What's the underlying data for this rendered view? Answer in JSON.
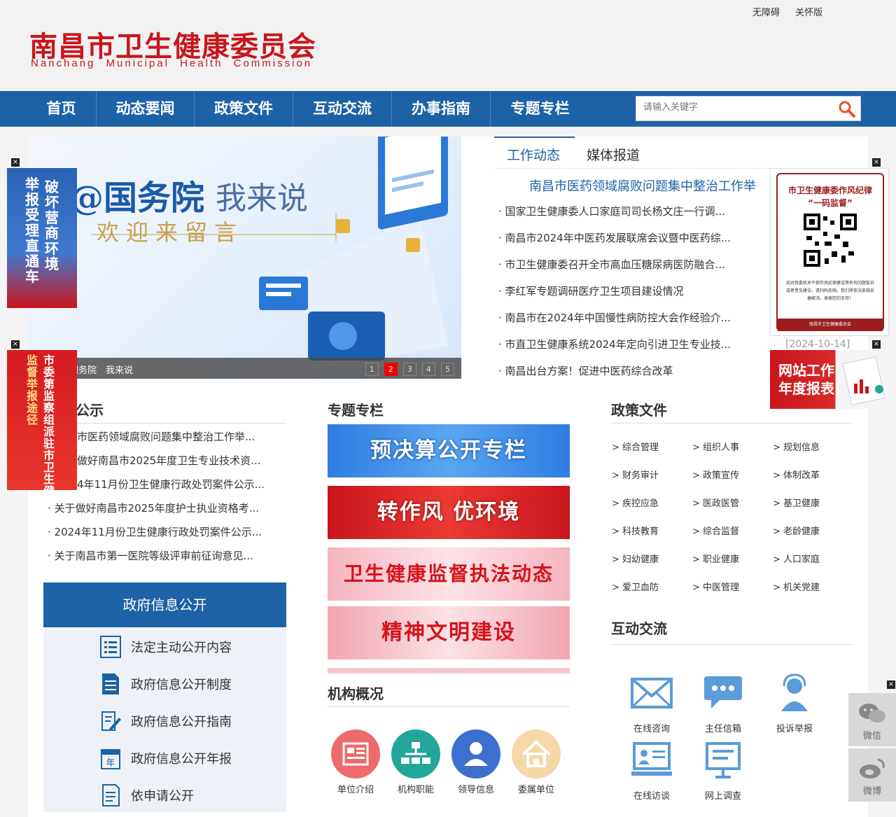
{
  "header": {
    "toplinks": [
      "无障碍",
      "关怀版"
    ],
    "logo_cn": "南昌市卫生健康委员会",
    "logo_en": "Nanchang Municipal Health Commission"
  },
  "nav": {
    "items": [
      "首页",
      "动态要闻",
      "政策文件",
      "互动交流",
      "办事指南",
      "专题专栏"
    ],
    "search_placeholder": "请输入关键字"
  },
  "banner": {
    "title_main": "@国务院",
    "title_sub": "我来说",
    "subtitle": "欢迎来留言",
    "caption": "@国务院　我来说",
    "pages": [
      "1",
      "2",
      "3",
      "4",
      "5"
    ],
    "active_page": 2
  },
  "news": {
    "tabs": [
      "工作动态",
      "媒体报道"
    ],
    "headline": "南昌市医药领域腐败问题集中整治工作举",
    "items": [
      "国家卫生健康委人口家庭司司长杨文庄一行调...",
      "南昌市2024年中医药发展联席会议暨中医药综...",
      "市卫生健康委召开全市高血压糖尿病医防融合...",
      "李红军专题调研医疗卫生项目建设情况",
      "南昌市在2024年中国慢性病防控大会作经验介...",
      "市直卫生健康系统2024年定向引进卫生专业技...",
      "南昌出台方案！促进中医药综合改革"
    ],
    "date": "[2024-10-14]"
  },
  "notice": {
    "title": "公示",
    "items": [
      "市医药领域腐败问题集中整治工作举...",
      "做好南昌市2025年度卫生专业技术资...",
      "4年11月份卫生健康行政处罚案件公示...",
      "关于做好南昌市2025年度护士执业资格考...",
      "2024年11月份卫生健康行政处罚案件公示...",
      "关于南昌市第一医院等级评审前征询意见..."
    ]
  },
  "gov_info": {
    "title": "政府信息公开",
    "items": [
      "法定主动公开内容",
      "政府信息公开制度",
      "政府信息公开指南",
      "政府信息公开年报",
      "依申请公开"
    ]
  },
  "topics": {
    "title": "专题专栏",
    "items": [
      "预决算公开专栏",
      "转作风 优环境",
      "卫生健康监督执法动态",
      "精神文明建设"
    ]
  },
  "org": {
    "title": "机构概况",
    "items": [
      "单位介绍",
      "机构职能",
      "领导信息",
      "委属单位"
    ]
  },
  "policy": {
    "title": "政策文件",
    "items": [
      "综合管理",
      "组织人事",
      "规划信息",
      "财务审计",
      "政策宣传",
      "体制改革",
      "疾控应急",
      "医政医管",
      "基卫健康",
      "科技教育",
      "综合监督",
      "老龄健康",
      "妇幼健康",
      "职业健康",
      "人口家庭",
      "爱卫血防",
      "中医管理",
      "机关党建"
    ]
  },
  "interaction": {
    "title": "互动交流",
    "items": [
      "在线咨询",
      "主任信箱",
      "投诉举报",
      "在线访谈",
      "网上调查"
    ]
  },
  "floats": {
    "left1_a": "破坏营商环境",
    "left1_b": "举报受理直通车",
    "left2_a": "市委第监察组派驻市卫生健康委",
    "left2_b": "监督举报途径",
    "qr_title": "市卫生健康委作风纪律",
    "qr_sub": "“一码监督”",
    "qr_desc": "如对我委机关干部作风纪律建设等有何问题投诉或者意见建议，请扫码反映。我们将依法依规妥善解决。谢谢您的支持！",
    "qr_footer": "南昌市卫生健康委员会",
    "report_title": "网站工作年度报表",
    "close": "×"
  },
  "side": {
    "wechat": "微信",
    "weibo": "微博"
  },
  "colors": {
    "brand_blue": "#1d62a6",
    "brand_red": "#c8161d"
  }
}
